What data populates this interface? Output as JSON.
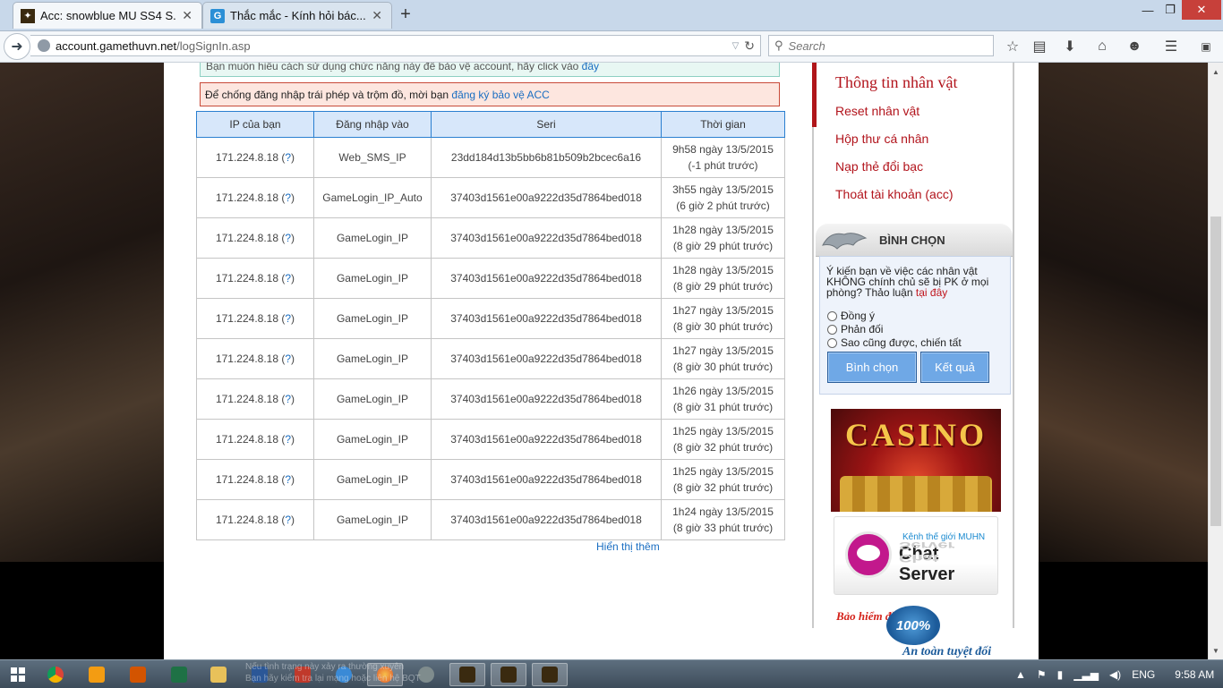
{
  "browser": {
    "tabs": [
      {
        "title": "Acc: snowblue MU SS4 S...",
        "active": true,
        "favicon": "mu-game-icon"
      },
      {
        "title": "Thắc mắc - Kính hỏi bác...",
        "active": false,
        "favicon": "g-site-icon"
      }
    ],
    "new_tab": "+",
    "window_controls": {
      "minimize": "—",
      "maximize": "❐",
      "close": "✕"
    },
    "url_host": "account.gamethuvn.net",
    "url_path": "/logSignIn.asp",
    "search_placeholder": "Search"
  },
  "page": {
    "notice_top_text": "Bạn muốn hiểu cách sử dụng chức năng này để bảo vệ account, hãy click vào",
    "notice_top_link": "đây",
    "notice_warn_text": "Để chống đăng nhập trái phép và trộm đồ, mời bạn",
    "notice_warn_link": "đăng ký bảo vệ ACC",
    "table": {
      "headers": [
        "IP của bạn",
        "Đăng nhập vào",
        "Seri",
        "Thời gian"
      ],
      "rows": [
        {
          "ip": "171.224.8.18",
          "q": "?",
          "login": "Web_SMS_IP",
          "seri": "23dd184d13b5bb6b81b509b2bcec6a16",
          "time1": "9h58 ngày 13/5/2015",
          "time2": "(-1 phút trước)"
        },
        {
          "ip": "171.224.8.18",
          "q": "?",
          "login": "GameLogin_IP_Auto",
          "seri": "37403d1561e00a9222d35d7864bed018",
          "time1": "3h55 ngày 13/5/2015",
          "time2": "(6 giờ 2 phút trước)"
        },
        {
          "ip": "171.224.8.18",
          "q": "?",
          "login": "GameLogin_IP",
          "seri": "37403d1561e00a9222d35d7864bed018",
          "time1": "1h28 ngày 13/5/2015",
          "time2": "(8 giờ 29 phút trước)"
        },
        {
          "ip": "171.224.8.18",
          "q": "?",
          "login": "GameLogin_IP",
          "seri": "37403d1561e00a9222d35d7864bed018",
          "time1": "1h28 ngày 13/5/2015",
          "time2": "(8 giờ 29 phút trước)"
        },
        {
          "ip": "171.224.8.18",
          "q": "?",
          "login": "GameLogin_IP",
          "seri": "37403d1561e00a9222d35d7864bed018",
          "time1": "1h27 ngày 13/5/2015",
          "time2": "(8 giờ 30 phút trước)"
        },
        {
          "ip": "171.224.8.18",
          "q": "?",
          "login": "GameLogin_IP",
          "seri": "37403d1561e00a9222d35d7864bed018",
          "time1": "1h27 ngày 13/5/2015",
          "time2": "(8 giờ 30 phút trước)"
        },
        {
          "ip": "171.224.8.18",
          "q": "?",
          "login": "GameLogin_IP",
          "seri": "37403d1561e00a9222d35d7864bed018",
          "time1": "1h26 ngày 13/5/2015",
          "time2": "(8 giờ 31 phút trước)"
        },
        {
          "ip": "171.224.8.18",
          "q": "?",
          "login": "GameLogin_IP",
          "seri": "37403d1561e00a9222d35d7864bed018",
          "time1": "1h25 ngày 13/5/2015",
          "time2": "(8 giờ 32 phút trước)"
        },
        {
          "ip": "171.224.8.18",
          "q": "?",
          "login": "GameLogin_IP",
          "seri": "37403d1561e00a9222d35d7864bed018",
          "time1": "1h25 ngày 13/5/2015",
          "time2": "(8 giờ 32 phút trước)"
        },
        {
          "ip": "171.224.8.18",
          "q": "?",
          "login": "GameLogin_IP",
          "seri": "37403d1561e00a9222d35d7864bed018",
          "time1": "1h24 ngày 13/5/2015",
          "time2": "(8 giờ 33 phút trước)"
        }
      ]
    },
    "show_more": "Hiển thị thêm"
  },
  "sidebar": {
    "title": "Thông tin nhân vật",
    "links": [
      "Reset nhân vật",
      "Hộp thư cá nhân",
      "Nạp thẻ đổi bạc",
      "Thoát tài khoản (acc)"
    ],
    "vote": {
      "heading": "BÌNH CHỌN",
      "question": "Ý kiến bạn về việc các nhân vật KHÔNG chính chủ sẽ bị PK ở mọi phòng? Thảo luận",
      "question_link": "tại đây",
      "options": [
        "Đồng ý",
        "Phản đối",
        "Sao cũng được, chiến tất"
      ],
      "vote_button": "Bình chọn",
      "result_button": "Kết quả"
    },
    "ads": {
      "casino": "CASINO",
      "chat_kicker": "Kênh thế giới MUHN",
      "chat_title": "Chat Server",
      "guarantee_top": "Bảo hiểm đồ",
      "guarantee_seal": "100%",
      "guarantee_bottom": "An toàn tuyệt đối"
    }
  },
  "taskbar": {
    "ghost_text_1": "Nếu tình trạng này xảy ra thường xuyên",
    "ghost_text_2": "Bạn hãy kiểm tra lại mạng hoặc liên hệ BQT",
    "language": "ENG",
    "clock": "9:58 AM"
  },
  "colors": {
    "accent_red": "#b2141c",
    "link_blue": "#1a6ec2",
    "table_header_bg": "#d7e7fa",
    "button_blue": "#6fa8e6"
  }
}
